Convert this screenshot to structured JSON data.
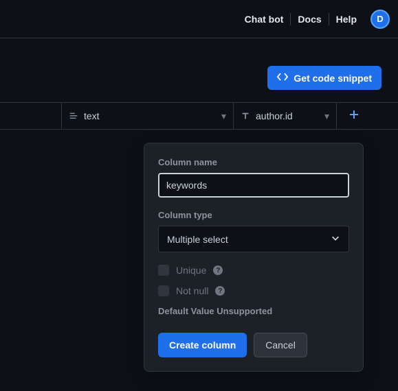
{
  "nav": {
    "chat": "Chat bot",
    "docs": "Docs",
    "help": "Help",
    "avatar_initial": "D"
  },
  "toolbar": {
    "code_snippet": "Get code snippet"
  },
  "columns": {
    "text": "text",
    "author_id": "author.id"
  },
  "popover": {
    "column_name_label": "Column name",
    "column_name_value": "keywords",
    "column_type_label": "Column type",
    "column_type_value": "Multiple select",
    "unique_label": "Unique",
    "notnull_label": "Not null",
    "default_unsupported": "Default Value Unsupported",
    "create_label": "Create column",
    "cancel_label": "Cancel"
  }
}
